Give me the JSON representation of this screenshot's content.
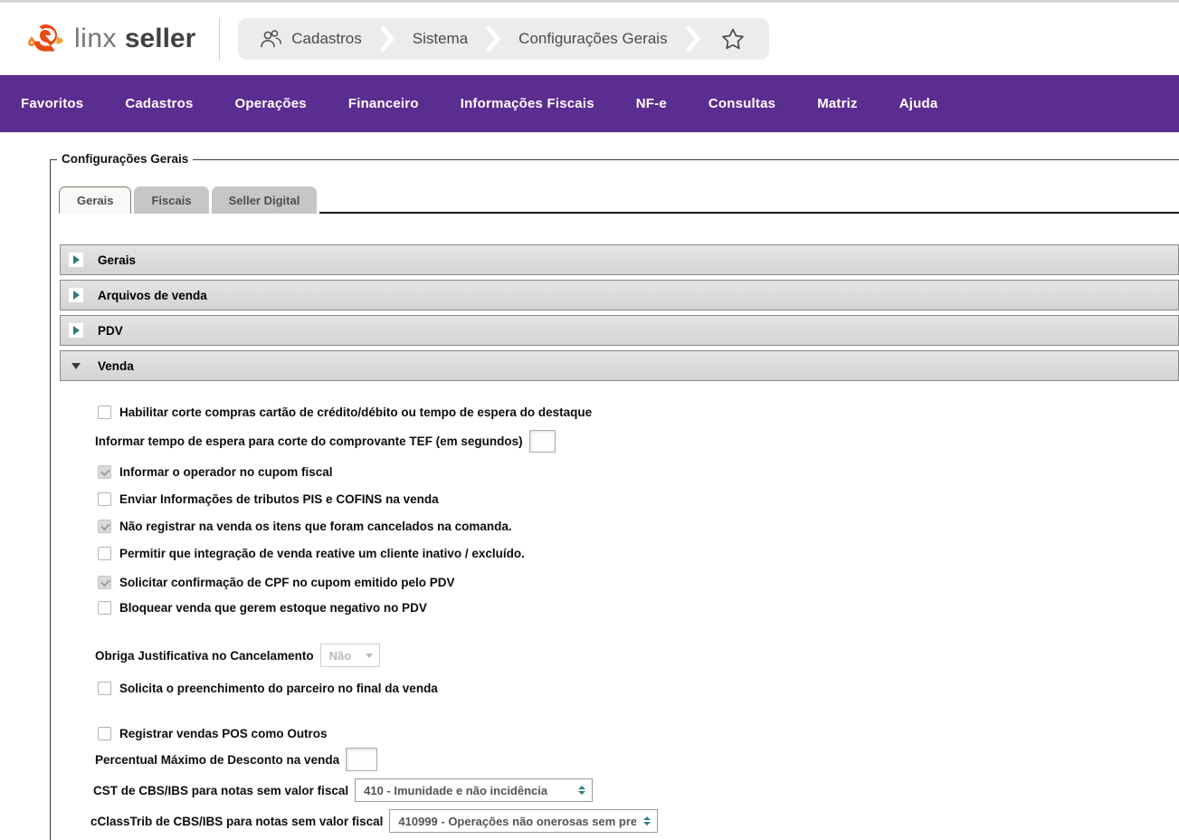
{
  "brand": {
    "name_light": "linx",
    "name_bold": "seller"
  },
  "breadcrumb": {
    "item1": "Cadastros",
    "item2": "Sistema",
    "item3": "Configurações Gerais"
  },
  "navbar": {
    "items": [
      "Favoritos",
      "Cadastros",
      "Operações",
      "Financeiro",
      "Informações Fiscais",
      "NF-e",
      "Consultas",
      "Matriz",
      "Ajuda"
    ]
  },
  "panel": {
    "legend": "Configurações Gerais",
    "tabs": {
      "t1": "Gerais",
      "t2": "Fiscais",
      "t3": "Seller Digital"
    },
    "sections": {
      "s1": "Gerais",
      "s2": "Arquivos de venda",
      "s3": "PDV",
      "s4": "Venda"
    }
  },
  "venda": {
    "cb_corte": "Habilitar corte compras cartão de crédito/débito ou tempo de espera do destaque",
    "tef_label": "Informar tempo de espera para corte do comprovante TEF (em segundos)",
    "tef_value": "",
    "cb_operador": "Informar o operador no cupom fiscal",
    "cb_pis": "Enviar Informações de tributos PIS e COFINS na venda",
    "cb_cancelados": "Não registrar na venda os itens que foram cancelados na comanda.",
    "cb_reativa": "Permitir que integração de venda reative um cliente inativo / excluído.",
    "cb_cpf": "Solicitar confirmação de CPF no cupom emitido pelo PDV",
    "cb_estoque": "Bloquear venda que gerem estoque negativo no PDV",
    "justificativa_label": "Obriga Justificativa no Cancelamento",
    "justificativa_value": "Não",
    "cb_parceiro": "Solicita o preenchimento do parceiro no final da venda",
    "cb_pos": "Registrar vendas POS como Outros",
    "desconto_label": "Percentual Máximo de Desconto na venda",
    "desconto_value": "",
    "cst_label": "CST de CBS/IBS para notas sem valor fiscal",
    "cst_value": "410 - Imunidade e não incidência",
    "cclasstrib_label": "cClassTrib de CBS/IBS para notas sem valor fiscal",
    "cclasstrib_value": "410999 - Operações não onerosas sem pre",
    "states": {
      "corte": false,
      "operador": true,
      "pis": false,
      "cancelados": true,
      "reativa": false,
      "cpf": true,
      "estoque": false,
      "parceiro": false,
      "pos": false
    }
  },
  "colors": {
    "nav_purple": "#5c2d91",
    "accent_teal": "#337b7b",
    "brand_orange": "#f58220",
    "brand_red_orange": "#e8490f"
  }
}
